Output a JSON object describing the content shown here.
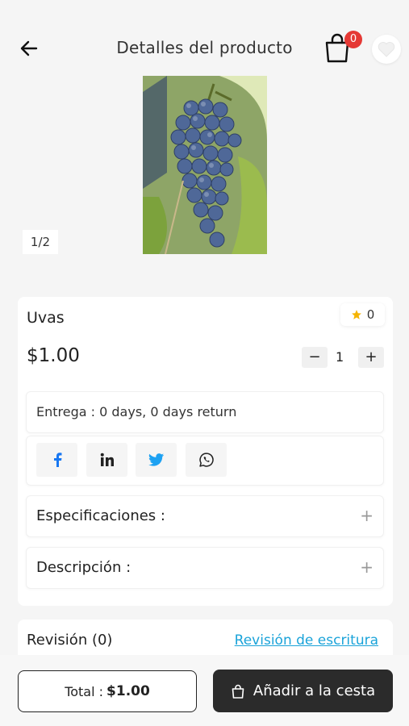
{
  "header": {
    "title": "Detalles del producto",
    "cart_count": "0"
  },
  "gallery": {
    "counter": "1/2"
  },
  "product": {
    "name": "Uvas",
    "rating": "0",
    "price": "$1.00",
    "quantity": "1",
    "delivery": "Entrega :  0 days, 0 days return"
  },
  "accordions": {
    "specs_label": "Especificaciones :",
    "desc_label": "Descripción :"
  },
  "review": {
    "title": "Revisión  (0)",
    "link": "Revisión de escritura"
  },
  "footer": {
    "total_label": "Total :",
    "total_value": "$1.00",
    "cart_button": "Añadir a la cesta"
  },
  "colors": {
    "badge": "#e53935",
    "link": "#1aa3d9",
    "primary_button": "#2b2b2b",
    "star": "#f5b400",
    "facebook": "#1877f2",
    "twitter": "#1da1f2"
  }
}
